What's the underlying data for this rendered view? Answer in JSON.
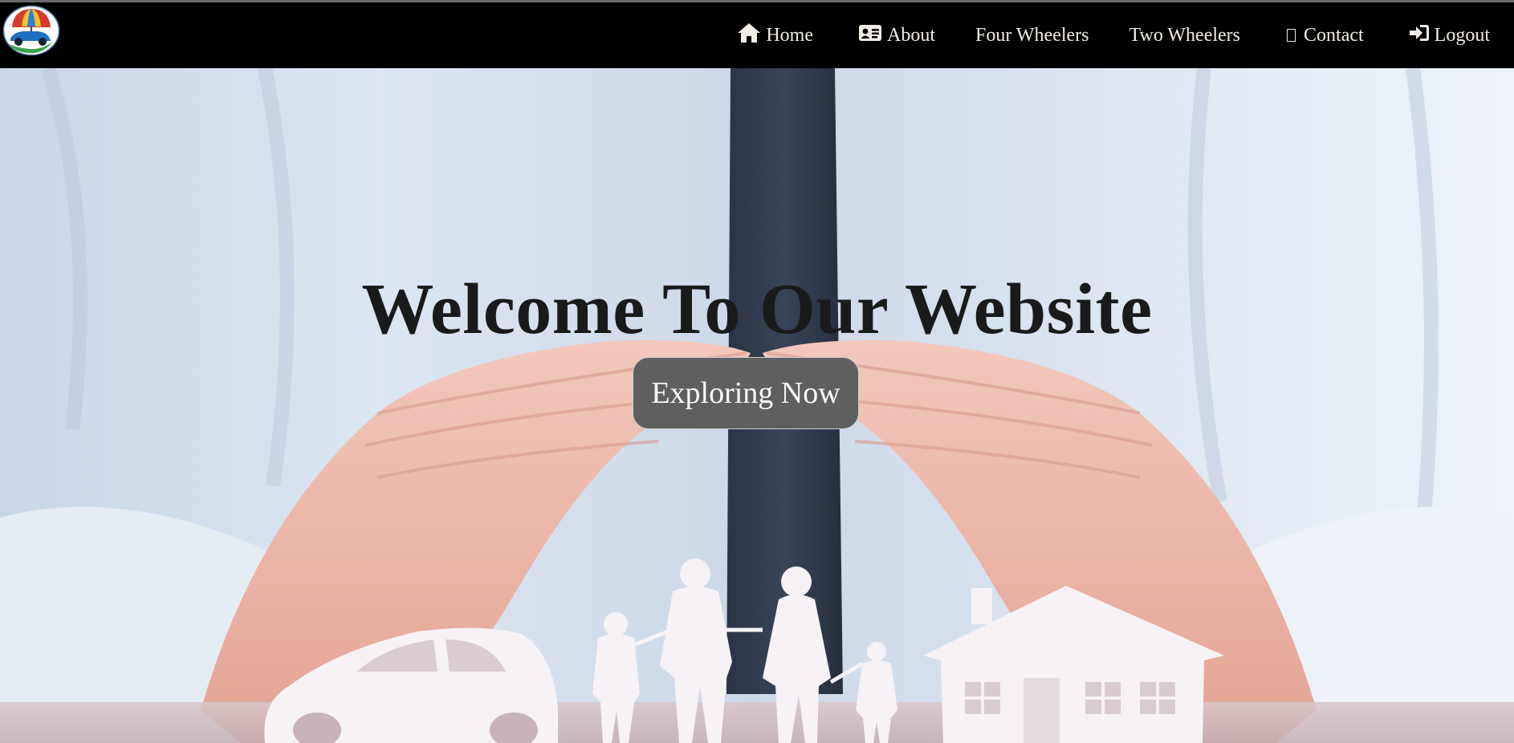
{
  "nav": {
    "logo_name": "umbrella-car-logo",
    "items": [
      {
        "label": "Home",
        "icon": "home-icon"
      },
      {
        "label": "About",
        "icon": "id-card-icon"
      },
      {
        "label": "Four Wheelers"
      },
      {
        "label": "Two Wheelers"
      },
      {
        "label": "Contact",
        "icon": "missing-glyph-icon"
      },
      {
        "label": "Logout",
        "icon": "sign-in-icon"
      }
    ]
  },
  "hero": {
    "title": "Welcome To Our Website",
    "button_label": "Exploring Now",
    "background": "hands-protecting-car-family-house-image"
  },
  "colors": {
    "navbar_bg": "#000000",
    "nav_text": "#f1ece4",
    "title_text": "#1a1a1a",
    "button_bg": "#5f5f5f",
    "button_text": "#fbfbfb"
  }
}
